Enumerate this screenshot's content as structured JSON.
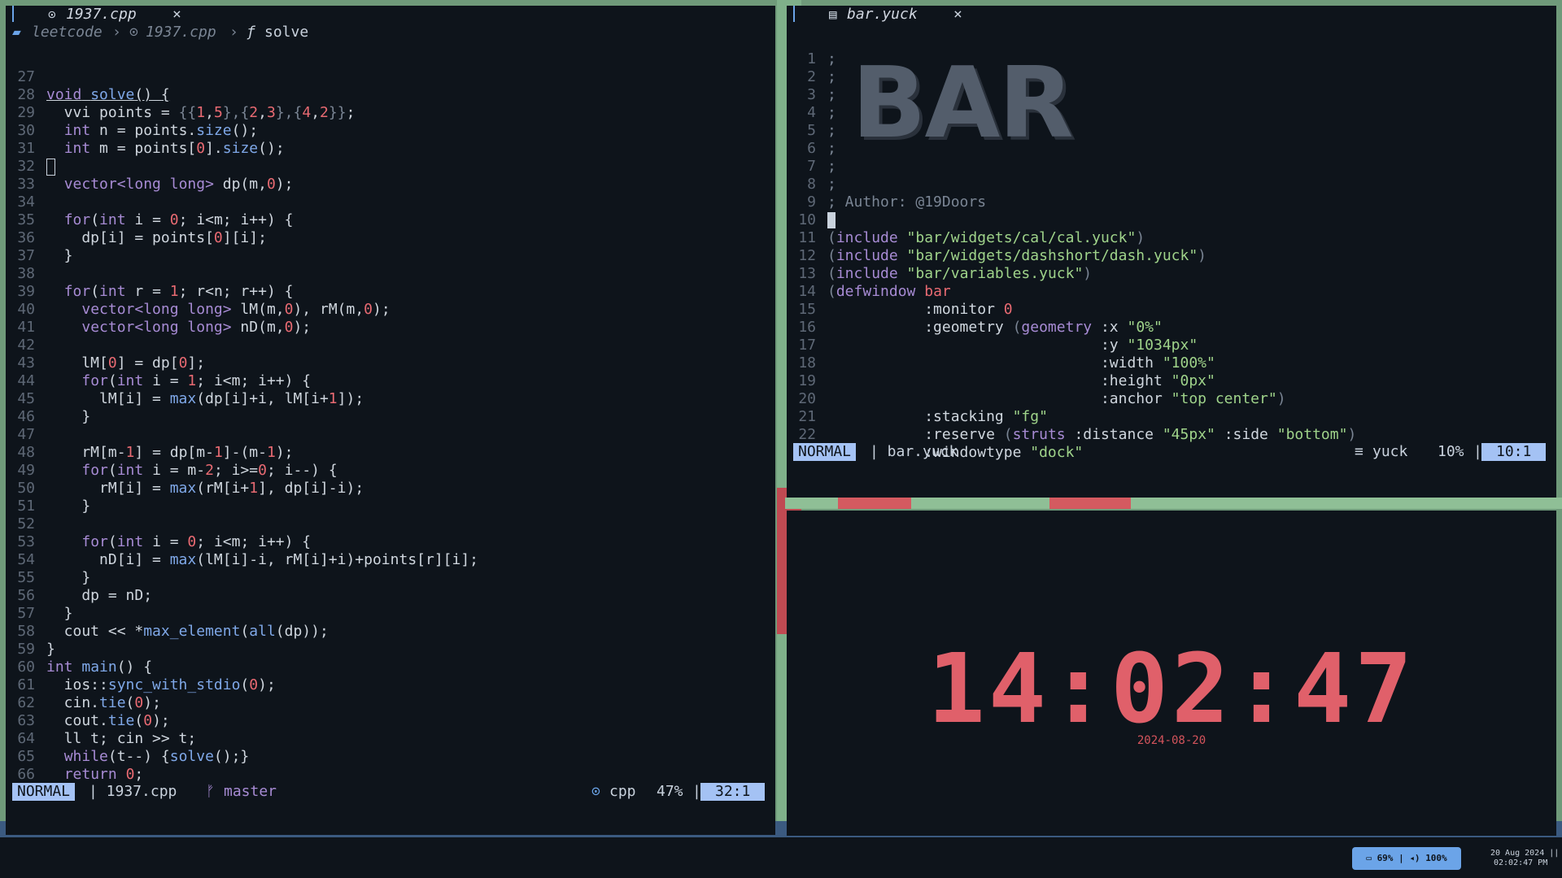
{
  "left_window": {
    "tab_title": "1937.cpp",
    "tab_close": "×",
    "breadcrumb": {
      "folder": "leetcode",
      "sep": "›",
      "file": "1937.cpp",
      "symbol": "solve"
    },
    "status": {
      "mode": "NORMAL",
      "file": "| 1937.cpp",
      "branch": "master",
      "filetype": "cpp",
      "percent": "47%",
      "position": "32:1"
    }
  },
  "right_window": {
    "tab_title": "bar.yuck",
    "tab_close": "×",
    "banner": "BAR",
    "status": {
      "mode": "NORMAL",
      "file": "| bar.yuck",
      "filetype": "yuck",
      "percent": "10%",
      "position": "10:1"
    }
  },
  "clock": {
    "time": "14:02:47",
    "date": "2024-08-20"
  },
  "taskbar": {
    "battery": "69%",
    "volume": "100%",
    "date": "20 Aug 2024 ||",
    "time": "02:02:47 PM"
  },
  "colors": {
    "accent": "#a4c2f4",
    "clock": "#e0606a",
    "bg": "#0e141b"
  }
}
